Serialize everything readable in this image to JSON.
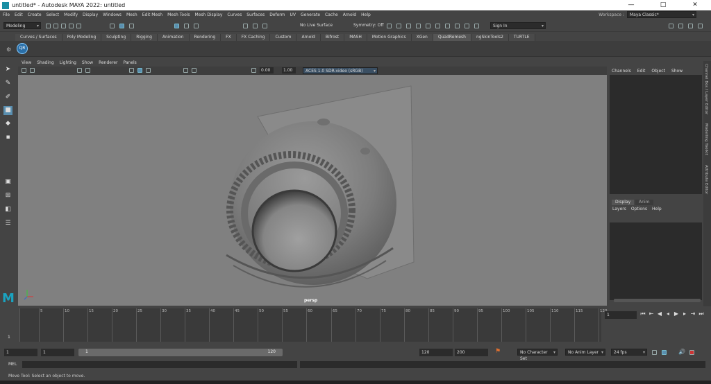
{
  "window": {
    "title": "untitled* - Autodesk MAYA 2022: untitled",
    "controls": [
      "—",
      "□",
      "✕"
    ]
  },
  "menubar": {
    "items": [
      "File",
      "Edit",
      "Create",
      "Select",
      "Modify",
      "Display",
      "Windows",
      "Mesh",
      "Edit Mesh",
      "Mesh Tools",
      "Mesh Display",
      "Curves",
      "Surfaces",
      "Deform",
      "UV",
      "Generate",
      "Cache",
      "Arnold",
      "Help"
    ],
    "workspace_label": "Workspace :",
    "workspace_value": "Maya Classic*"
  },
  "statusline": {
    "menuset": "Modeling",
    "live_surface": "No Live Surface",
    "symmetry": "Symmetry: Off",
    "sign_in": "Sign In"
  },
  "shelf": {
    "tabs": [
      "Curves / Surfaces",
      "Poly Modeling",
      "Sculpting",
      "Rigging",
      "Animation",
      "Rendering",
      "FX",
      "FX Caching",
      "Custom",
      "Arnold",
      "Bifrost",
      "MASH",
      "Motion Graphics",
      "XGen",
      "QuadRemesh",
      "ngSkinTools2",
      "TURTLE"
    ],
    "active_tab": "QuadRemesh",
    "qr_button": "QR"
  },
  "viewport": {
    "menu": [
      "View",
      "Shading",
      "Lighting",
      "Show",
      "Renderer",
      "Panels"
    ],
    "exposure": "0.00",
    "gamma": "1.00",
    "color_space": "ACES 1.0 SDR-video (sRGB)",
    "camera": "persp"
  },
  "channel_box": {
    "menu": [
      "Channels",
      "Edit",
      "Object",
      "Show"
    ],
    "layer_tabs": [
      "Display",
      "Anim"
    ],
    "layer_menu": [
      "Layers",
      "Options",
      "Help"
    ]
  },
  "side_tabs": [
    "Channel Box / Layer Editor",
    "Modelling Toolkit",
    "Attribute Editor"
  ],
  "timeline": {
    "ticks": [
      "1",
      "5",
      "10",
      "15",
      "20",
      "25",
      "30",
      "35",
      "40",
      "45",
      "50",
      "55",
      "60",
      "65",
      "70",
      "75",
      "80",
      "85",
      "90",
      "95",
      "100",
      "105",
      "110",
      "115",
      "120"
    ],
    "current_frame": "1",
    "frame_label": "1"
  },
  "range": {
    "start": "1",
    "playback_start": "1",
    "slider_start": "1",
    "slider_end": "120",
    "playback_end": "120",
    "end": "200",
    "character_set": "No Character Set",
    "anim_layer": "No Anim Layer",
    "fps": "24 fps"
  },
  "command_line": {
    "label": "MEL"
  },
  "help_line": {
    "text": "Move Tool: Select an object to move."
  }
}
